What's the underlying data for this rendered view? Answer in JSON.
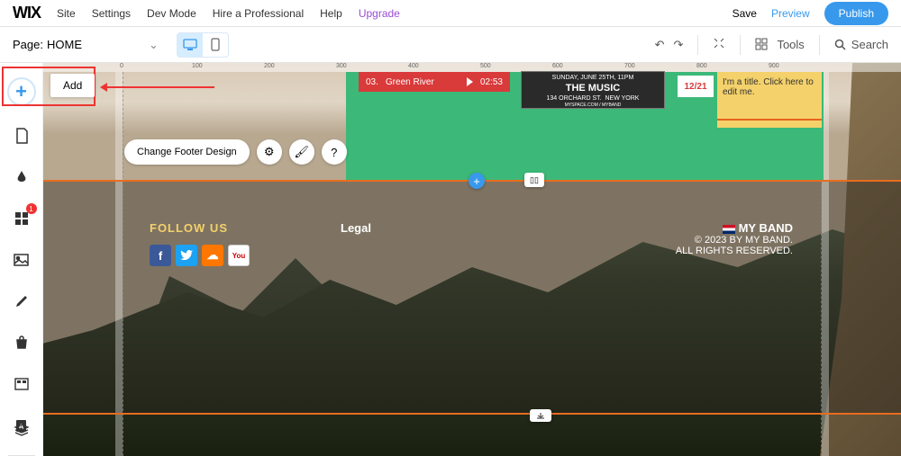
{
  "app": {
    "logo": "WIX"
  },
  "topmenu": {
    "site": "Site",
    "settings": "Settings",
    "devmode": "Dev Mode",
    "hire": "Hire a Professional",
    "help": "Help",
    "upgrade": "Upgrade"
  },
  "topright": {
    "save": "Save",
    "preview": "Preview",
    "publish": "Publish"
  },
  "toolbar": {
    "page_label": "Page:",
    "page_name": "HOME",
    "tools": "Tools",
    "search": "Search"
  },
  "tooltip": {
    "add": "Add"
  },
  "ruler": {
    "t0": "0",
    "t100": "100",
    "t200": "200",
    "t300": "300",
    "t400": "400",
    "t500": "500",
    "t600": "600",
    "t700": "700",
    "t800": "800",
    "t900": "900"
  },
  "music": {
    "track_no": "03.",
    "track_name": "Green River",
    "time": "02:53",
    "venue_day": "SUNDAY, JUNE 25TH, 11PM",
    "venue_name": "THE MUSIC",
    "venue_addr1": "134 ORCHARD ST.",
    "venue_city": "NEW YORK",
    "venue_site": "MYSPACE.COM / MYBAND",
    "date": "12/21",
    "title_text": "I'm a title. Click here to edit me."
  },
  "floatbar": {
    "change_footer": "Change Footer Design"
  },
  "carousel": {
    "indicator": "▯▯"
  },
  "footer": {
    "follow": "FOLLOW US",
    "legal": "Legal",
    "band": "MY BAND",
    "copyright": "© 2023 BY MY BAND.",
    "rights": "ALL RIGHTS RESERVED.",
    "social": {
      "fb": "f",
      "tw": "t",
      "sc": "☁",
      "yt": "You"
    }
  },
  "leftbar": {
    "apps_badge": "1"
  }
}
